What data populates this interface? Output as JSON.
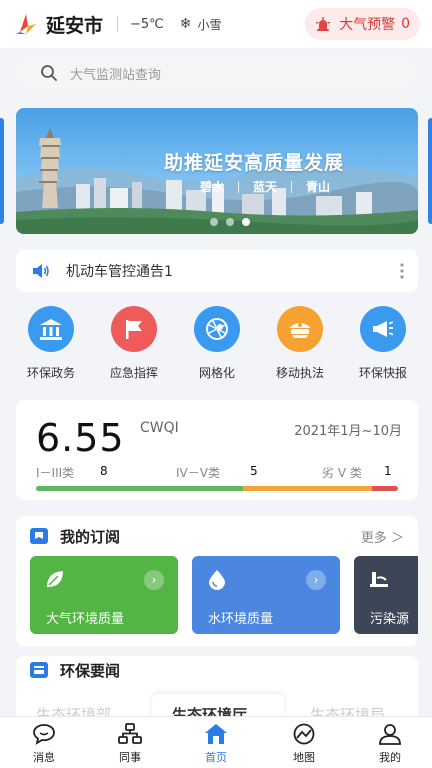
{
  "header": {
    "city": "延安市",
    "temperature": "−5℃",
    "weather_icon": "snowflake-icon",
    "weather": "小雪",
    "alert_label": "大气预警",
    "alert_count": "0"
  },
  "search": {
    "placeholder": "大气监测站查询"
  },
  "banner": {
    "title": "助推延安高质量发展",
    "tags": [
      "碧水",
      "蓝天",
      "青山"
    ],
    "slide_count": 3,
    "active_slide": 3
  },
  "notice": {
    "text": "机动车管控通告1"
  },
  "quick_actions": [
    {
      "label": "环保政务",
      "icon": "government-building-icon",
      "color": "#3a9af0"
    },
    {
      "label": "应急指挥",
      "icon": "flag-icon",
      "color": "#ef5a5a"
    },
    {
      "label": "网格化",
      "icon": "grid-map-icon",
      "color": "#3a9af0"
    },
    {
      "label": "移动执法",
      "icon": "officer-cap-icon",
      "color": "#f5a233"
    },
    {
      "label": "环保快报",
      "icon": "megaphone-icon",
      "color": "#3a9af0"
    }
  ],
  "cwqi": {
    "value": "6.55",
    "unit": "CWQI",
    "period": "2021年1月~10月",
    "levels": [
      {
        "label": "I－III类",
        "count": "8",
        "color": "#5fb663"
      },
      {
        "label": "IV－V类",
        "count": "5",
        "color": "#f0a534"
      },
      {
        "label": "劣 V 类",
        "count": "1",
        "color": "#e05252"
      }
    ]
  },
  "subscriptions": {
    "title": "我的订阅",
    "more": "更多 ＞",
    "cards": [
      {
        "label": "大气环境质量",
        "icon": "leaf-icon",
        "color": "#52b544"
      },
      {
        "label": "水环境质量",
        "icon": "water-drop-icon",
        "color": "#4b87e0"
      },
      {
        "label": "污染源",
        "icon": "factory-icon",
        "color": "#3c4656"
      }
    ]
  },
  "news": {
    "title": "环保要闻",
    "tabs": [
      "生态环境部",
      "生态环境厅",
      "生态环境局"
    ],
    "active_tab": 1
  },
  "tabbar": [
    {
      "label": "消息",
      "icon": "chat-bubble-icon"
    },
    {
      "label": "同事",
      "icon": "org-chart-icon"
    },
    {
      "label": "首页",
      "icon": "home-icon",
      "active": true
    },
    {
      "label": "地图",
      "icon": "map-gauge-icon"
    },
    {
      "label": "我的",
      "icon": "user-icon"
    }
  ],
  "colors": {
    "accent": "#2b7be4",
    "alert": "#d93a3a"
  }
}
